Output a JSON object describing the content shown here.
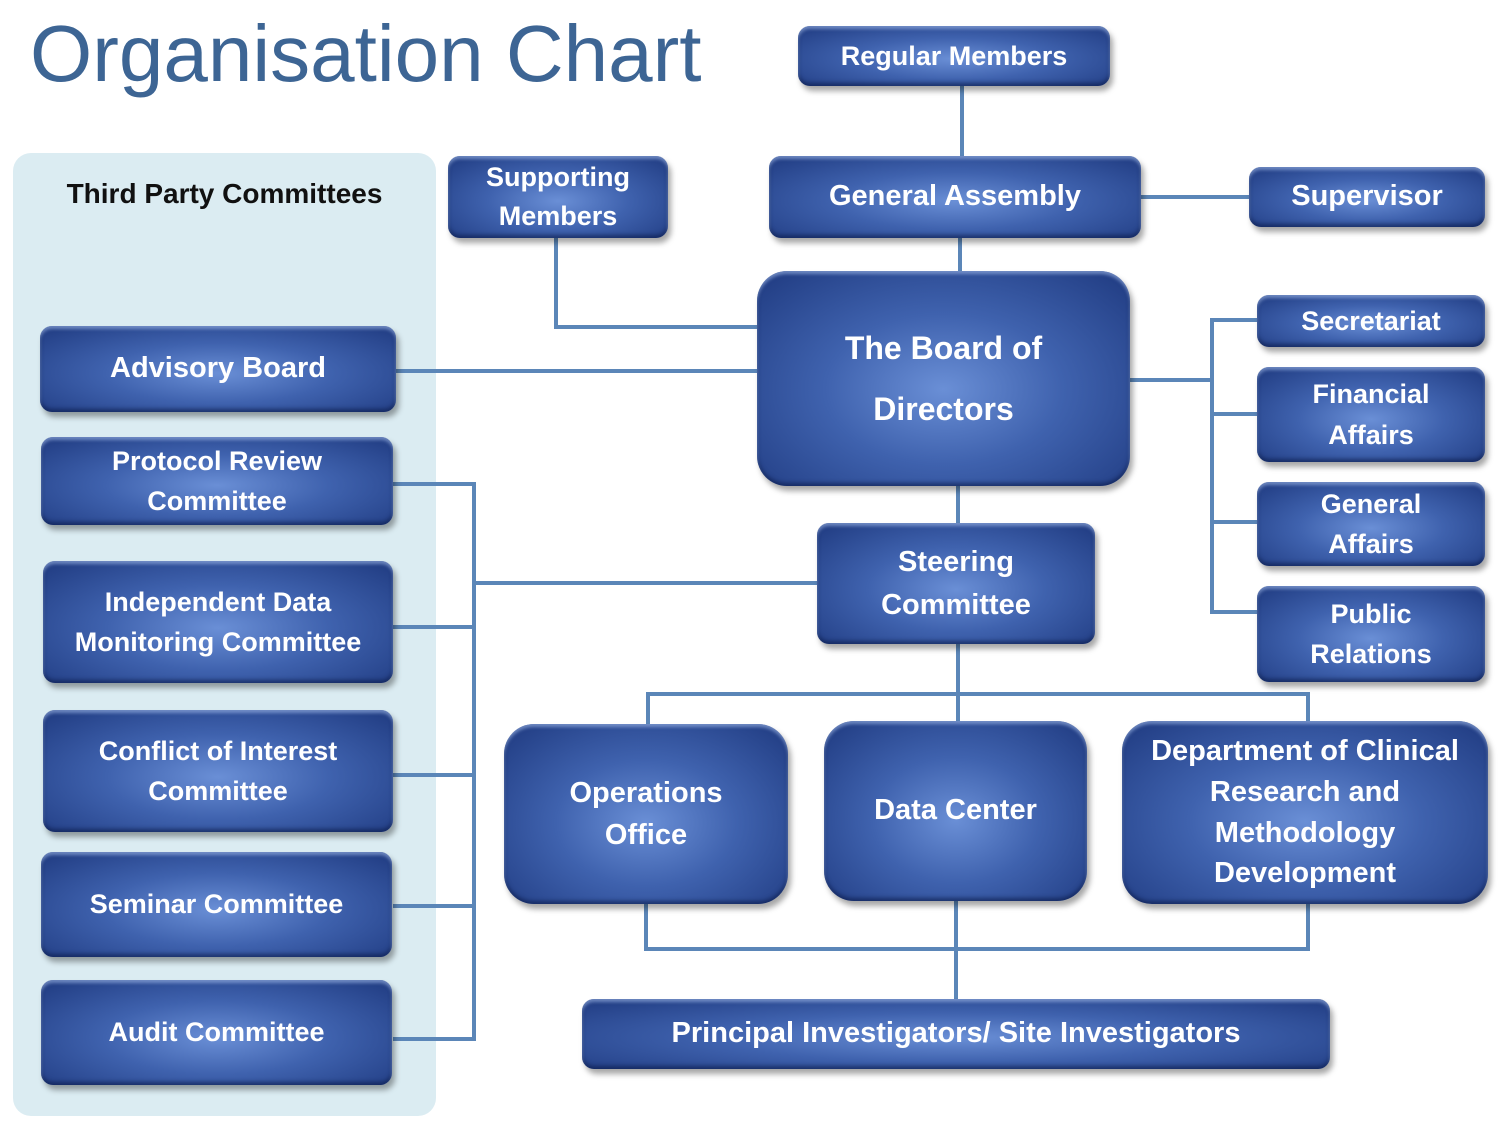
{
  "title": "Organisation Chart",
  "panel": {
    "title": "Third Party Committees"
  },
  "nodes": {
    "regular_members": "Regular Members",
    "supporting_members": "Supporting Members",
    "general_assembly": "General Assembly",
    "supervisor": "Supervisor",
    "board_of_directors": "The Board of Directors",
    "secretariat": "Secretariat",
    "financial_affairs": "Financial Affairs",
    "general_affairs": "General Affairs",
    "public_relations": "Public Relations",
    "steering_committee": "Steering Committee",
    "operations_office": "Operations Office",
    "data_center": "Data Center",
    "dept_clinical_research": "Department of Clinical Research and Methodology Development",
    "principal_investigators": "Principal Investigators/ Site Investigators",
    "advisory_board": "Advisory Board",
    "protocol_review": "Protocol Review Committee",
    "idmc": "Independent Data Monitoring Committee",
    "conflict_of_interest": "Conflict of Interest Committee",
    "seminar_committee": "Seminar Committee",
    "audit_committee": "Audit Committee"
  },
  "colors": {
    "title": "#3d6594",
    "node_dark": "#1f3a80",
    "node_light": "#6a8fd6",
    "connector": "#5b86b8",
    "panel_bg": "#dbecf2"
  }
}
